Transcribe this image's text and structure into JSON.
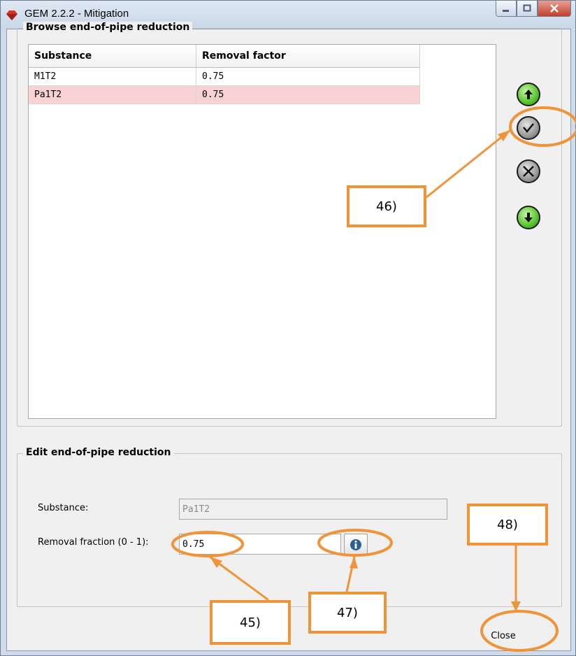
{
  "window": {
    "title": "GEM 2.2.2 - Mitigation"
  },
  "browse": {
    "group_title": "Browse end-of-pipe reduction",
    "columns": [
      "Substance",
      "Removal factor"
    ],
    "rows": [
      {
        "substance": "M1T2",
        "removal_factor": "0.75",
        "selected": false
      },
      {
        "substance": "Pa1T2",
        "removal_factor": "0.75",
        "selected": true
      }
    ],
    "buttons": [
      "move-up",
      "confirm",
      "delete",
      "move-down"
    ]
  },
  "edit": {
    "group_title": "Edit end-of-pipe reduction",
    "substance_label": "Substance:",
    "substance_value": "Pa1T2",
    "removal_label": "Removal fraction (0 - 1):",
    "removal_value": "0.75"
  },
  "close_label": "Close",
  "annotations": {
    "callout_45": "45)",
    "callout_46": "46)",
    "callout_47": "47)",
    "callout_48": "48)",
    "color": "#f0943a"
  },
  "colors": {
    "selected_row": "#f9d3d3",
    "accent_green": "#57c52d"
  }
}
